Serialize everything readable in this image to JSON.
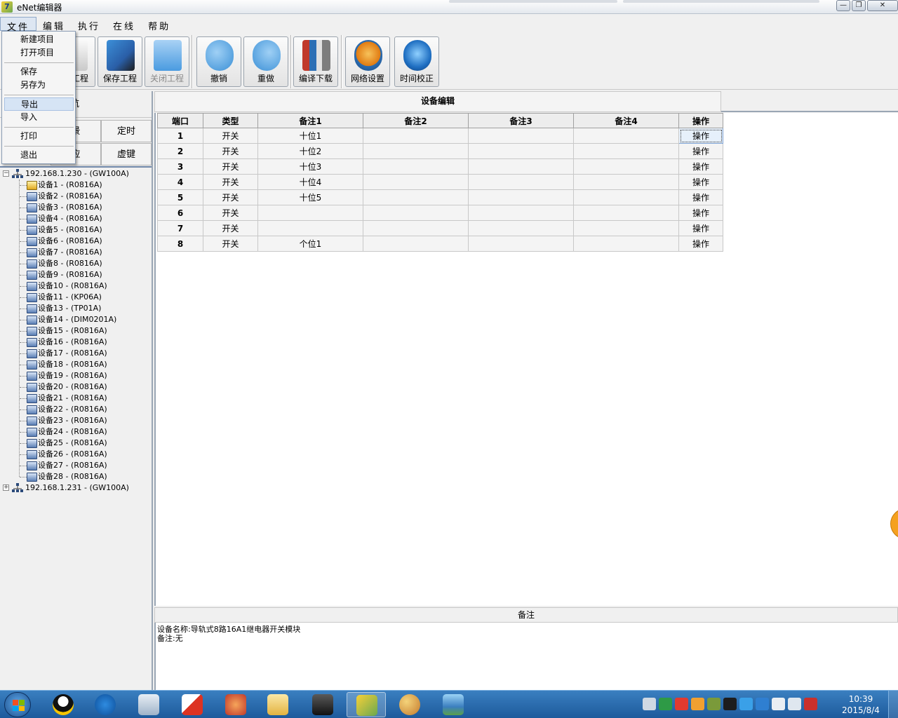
{
  "window": {
    "title": "eNet编辑器",
    "app_icon_glyph": "7",
    "min_glyph": "—",
    "restore_glyph": "❐",
    "close_glyph": "✕"
  },
  "menubar": {
    "items": [
      "文件",
      "编辑",
      "执行",
      "在线",
      "帮助"
    ],
    "open_menu": "文件"
  },
  "file_menu": {
    "items": [
      "新建项目",
      "打开项目",
      "保存",
      "另存为",
      "导出",
      "导入",
      "打印",
      "退出"
    ],
    "highlighted": "导出"
  },
  "toolbar": {
    "buttons": [
      {
        "label": "工程",
        "icon": "new-project-icon",
        "enabled": true
      },
      {
        "label": "保存工程",
        "icon": "save-project-icon",
        "enabled": true
      },
      {
        "label": "关闭工程",
        "icon": "close-project-icon",
        "enabled": false
      },
      {
        "label": "撤销",
        "icon": "undo-icon",
        "enabled": true
      },
      {
        "label": "重做",
        "icon": "redo-icon",
        "enabled": true
      },
      {
        "label": "编译下载",
        "icon": "compile-download-icon",
        "enabled": true
      },
      {
        "label": "网络设置",
        "icon": "network-settings-icon",
        "enabled": true
      },
      {
        "label": "时间校正",
        "icon": "time-sync-icon",
        "enabled": true
      }
    ]
  },
  "left_panel": {
    "header": "航",
    "nav_buttons": [
      "景",
      "定时",
      "应",
      "虚键"
    ],
    "tree": {
      "gateways": [
        {
          "label": "192.168.1.230 - (GW100A)",
          "expanded": true,
          "expander": "−",
          "devices": [
            "设备1 - (R0816A)",
            "设备2 - (R0816A)",
            "设备3 - (R0816A)",
            "设备4 - (R0816A)",
            "设备5 - (R0816A)",
            "设备6 - (R0816A)",
            "设备7 - (R0816A)",
            "设备8 - (R0816A)",
            "设备9 - (R0816A)",
            "设备10 - (R0816A)",
            "设备11 - (KP06A)",
            "设备13 - (TP01A)",
            "设备14 - (DIM0201A)",
            "设备15 - (R0816A)",
            "设备16 - (R0816A)",
            "设备17 - (R0816A)",
            "设备18 - (R0816A)",
            "设备19 - (R0816A)",
            "设备20 - (R0816A)",
            "设备21 - (R0816A)",
            "设备22 - (R0816A)",
            "设备23 - (R0816A)",
            "设备24 - (R0816A)",
            "设备25 - (R0816A)",
            "设备26 - (R0816A)",
            "设备27 - (R0816A)",
            "设备28 - (R0816A)"
          ]
        },
        {
          "label": "192.168.1.231 - (GW100A)",
          "expanded": false,
          "expander": "+",
          "devices": []
        }
      ]
    }
  },
  "editor": {
    "title": "设备编辑",
    "columns": [
      "端口",
      "类型",
      "备注1",
      "备注2",
      "备注3",
      "备注4",
      "操作"
    ],
    "rows": [
      [
        "1",
        "开关",
        "十位1",
        "",
        "",
        "",
        "操作"
      ],
      [
        "2",
        "开关",
        "十位2",
        "",
        "",
        "",
        "操作"
      ],
      [
        "3",
        "开关",
        "十位3",
        "",
        "",
        "",
        "操作"
      ],
      [
        "4",
        "开关",
        "十位4",
        "",
        "",
        "",
        "操作"
      ],
      [
        "5",
        "开关",
        "十位5",
        "",
        "",
        "",
        "操作"
      ],
      [
        "6",
        "开关",
        "",
        "",
        "",
        "",
        "操作"
      ],
      [
        "7",
        "开关",
        "",
        "",
        "",
        "",
        "操作"
      ],
      [
        "8",
        "开关",
        "个位1",
        "",
        "",
        "",
        "操作"
      ]
    ]
  },
  "notes": {
    "title": "备注",
    "line1": "设备名称:导轨式8路16A1继电器开关模块",
    "line2": "备注:无"
  },
  "taskbar": {
    "apps": [
      "qq-icon",
      "sogou-input-icon",
      "calculator-icon",
      "solitaire-icon",
      "game-icon",
      "file-explorer-icon",
      "media-icon",
      "enet-editor-icon",
      "paint-icon",
      "photo-viewer-icon"
    ],
    "active_app": "enet-editor-icon",
    "clock_time": "10:39",
    "clock_date": "2015/8/4"
  },
  "colors": {
    "accent": "#1d5a9c",
    "selection": "#d6e4f5",
    "taskbar": "#2f6fb0"
  }
}
